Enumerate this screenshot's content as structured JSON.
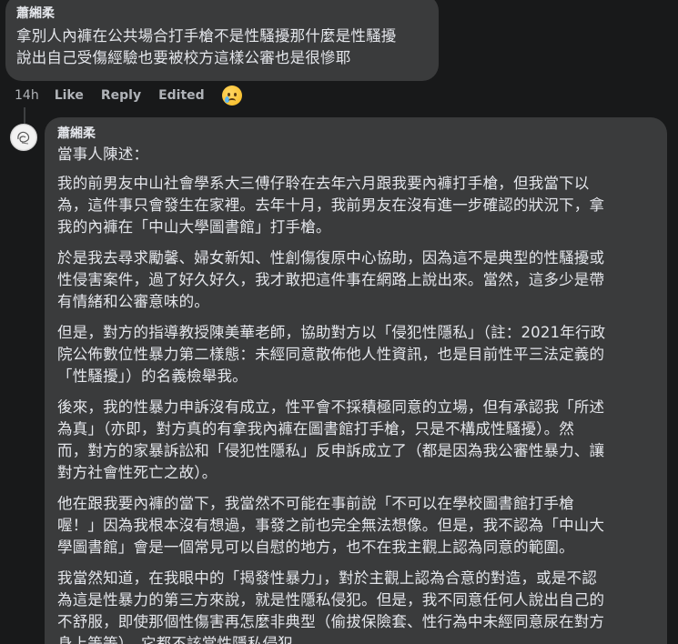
{
  "comment": {
    "author": "蕭緗柔",
    "text": "拿別人內褲在公共場合打手槍不是性騷擾那什麼是性騷擾\n說出自己受傷經驗也要被校方這樣公審也是很慘耶",
    "time": "14h",
    "actions": {
      "like": "Like",
      "reply": "Reply",
      "edited": "Edited"
    },
    "reaction_icon": "crying-face-emoji"
  },
  "reply": {
    "author": "蕭緗柔",
    "avatar_icon": "profile-avatar",
    "paragraphs": [
      "當事人陳述：",
      "我的前男友中山社會學系大三傅仔聆在去年六月跟我要內褲打手槍，但我當下以\n為，這件事只會發生在家裡。去年十月，我前男友在沒有進一步確認的狀況下，拿\n我的內褲在「中山大學圖書館」打手槍。",
      "於是我去尋求勵馨、婦女新知、性創傷復原中心協助，因為這不是典型的性騷擾或\n性侵害案件，過了好久好久，我才敢把這件事在網路上說出來。當然，這多少是帶\n有情緒和公審意味的。",
      "但是，對方的指導教授陳美華老師，協助對方以「侵犯性隱私」（註：2021年行政\n院公佈數位性暴力第二樣態：未經同意散佈他人性資訊，也是目前性平三法定義的\n「性騷擾」）的名義檢舉我。",
      "後來，我的性暴力申訴沒有成立，性平會不採積極同意的立場，但有承認我「所述\n為真」（亦即，對方真的有拿我內褲在圖書館打手槍，只是不構成性騷擾）。然\n而，對方的家暴訴訟和「侵犯性隱私」反申訴成立了（都是因為我公審性暴力、讓\n對方社會性死亡之故）。",
      "他在跟我要內褲的當下，我當然不可能在事前說「不可以在學校圖書館打手槍\n喔！」因為我根本沒有想過，事發之前也完全無法想像。但是，我不認為「中山大\n學圖書館」會是一個常見可以自慰的地方，也不在我主觀上認為同意的範圍。",
      "我當然知道，在我眼中的「揭發性暴力」，對於主觀上認為合意的對造，或是不認\n為這是性暴力的第三方來說，就是性隱私侵犯。但是，我不同意任何人說出自己的\n不舒服，即使那個性傷害再怎麼非典型（偷拔保險套、性行為中未經同意尿在對方\n身上等等），它都不該當性隱私侵犯。"
    ]
  }
}
